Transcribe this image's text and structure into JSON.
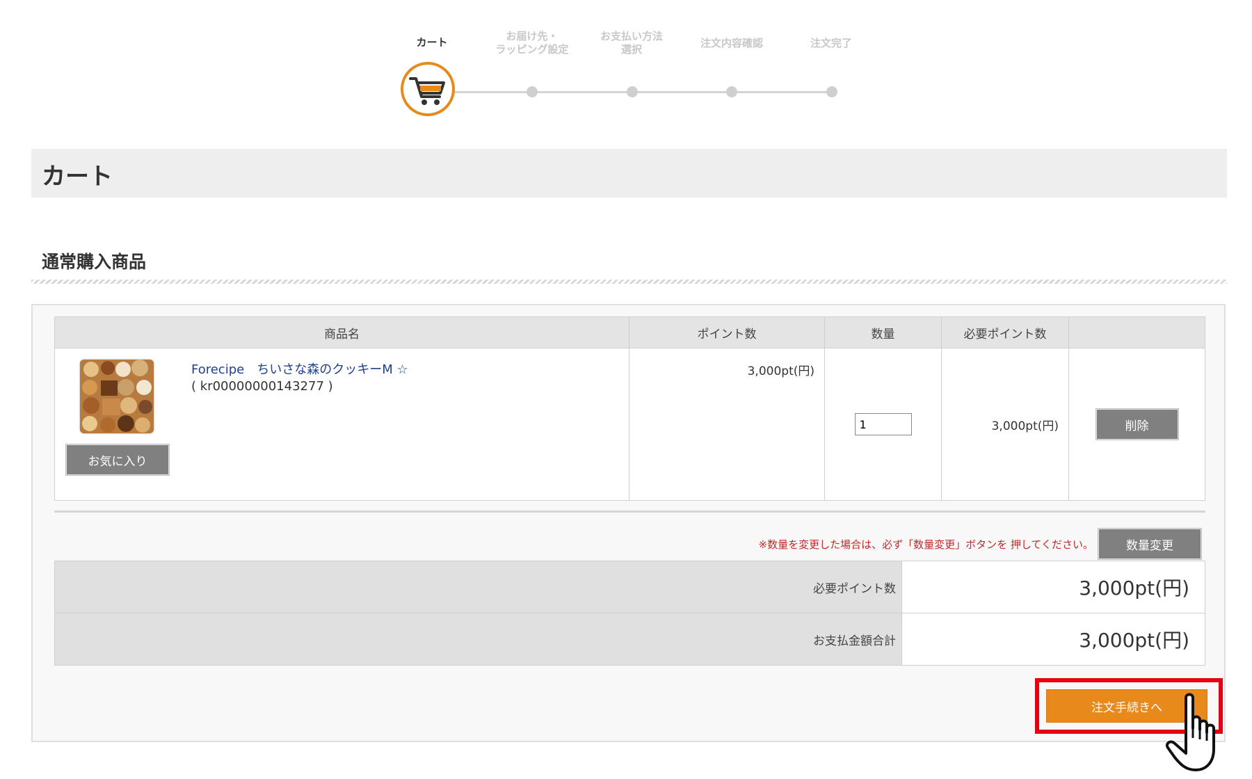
{
  "steps": [
    {
      "label": "カート",
      "active": true
    },
    {
      "label": "お届け先・\nラッピング設定",
      "active": false
    },
    {
      "label": "お支払い方法\n選択",
      "active": false
    },
    {
      "label": "注文内容確認",
      "active": false
    },
    {
      "label": "注文完了",
      "active": false
    }
  ],
  "page_title": "カート",
  "section_title": "通常購入商品",
  "table": {
    "headers": [
      "商品名",
      "ポイント数",
      "数量",
      "必要ポイント数",
      ""
    ],
    "rows": [
      {
        "product_name": "Forecipe　ちいさな森のクッキーM ☆",
        "product_code": "( kr00000000143277 )",
        "points": "3,000pt(円)",
        "quantity": "1",
        "required_points": "3,000pt(円)",
        "favorite_label": "お気に入り",
        "delete_label": "削除"
      }
    ]
  },
  "notice": "※数量を変更した場合は、必ず「数量変更」ボタンを 押してください。",
  "qty_change_label": "数量変更",
  "totals": [
    {
      "label": "必要ポイント数",
      "value": "3,000pt(円)"
    },
    {
      "label": "お支払金額合計",
      "value": "3,000pt(円)"
    }
  ],
  "checkout_label": "注文手続きへ",
  "colors": {
    "accent": "#e8891b",
    "highlight": "#e50012",
    "link": "#1f3f8f",
    "notice": "#c62828"
  },
  "icons": [
    "cart-icon",
    "pointer-hand-icon"
  ]
}
